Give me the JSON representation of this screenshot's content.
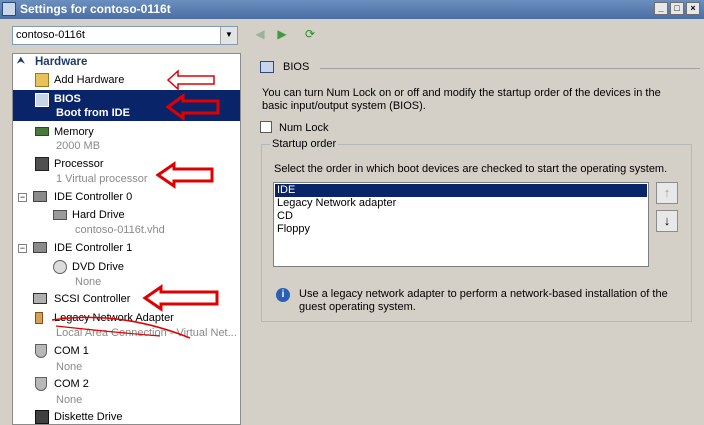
{
  "window": {
    "title": "Settings for contoso-0116t"
  },
  "vm_selector": {
    "value": "contoso-0116t"
  },
  "hardware": {
    "section_label": "Hardware",
    "items": [
      {
        "name": "Add Hardware",
        "icon": "add-hardware-icon"
      },
      {
        "name": "BIOS",
        "sub": "Boot from IDE",
        "icon": "bios-icon"
      },
      {
        "name": "Memory",
        "sub": "2000 MB",
        "icon": "memory-icon"
      },
      {
        "name": "Processor",
        "sub": "1 Virtual processor",
        "icon": "processor-icon"
      },
      {
        "name": "IDE Controller 0",
        "icon": "ide-controller-icon"
      },
      {
        "name": "Hard Drive",
        "sub": "contoso-0116t.vhd",
        "icon": "hard-drive-icon"
      },
      {
        "name": "IDE Controller 1",
        "icon": "ide-controller-icon"
      },
      {
        "name": "DVD Drive",
        "sub": "None",
        "icon": "dvd-drive-icon"
      },
      {
        "name": "SCSI Controller",
        "icon": "scsi-controller-icon"
      },
      {
        "name": "Legacy Network Adapter",
        "sub": "Local Area Connection - Virtual Net...",
        "icon": "network-adapter-icon"
      },
      {
        "name": "COM 1",
        "sub": "None",
        "icon": "com-port-icon"
      },
      {
        "name": "COM 2",
        "sub": "None",
        "icon": "com-port-icon"
      },
      {
        "name": "Diskette Drive",
        "icon": "diskette-icon"
      }
    ]
  },
  "bios_panel": {
    "header": "BIOS",
    "description": "You can turn Num Lock on or off and modify the startup order of the devices in the basic input/output system (BIOS).",
    "num_lock_label": "Num Lock",
    "num_lock_checked": false,
    "startup_group_label": "Startup order",
    "startup_instruction": "Select the order in which boot devices are checked to start the operating system.",
    "boot_devices": [
      "IDE",
      "Legacy Network adapter",
      "CD",
      "Floppy"
    ],
    "selected_device": "IDE",
    "info_text": "Use a legacy network adapter to perform a network-based installation of the guest operating system."
  },
  "colors": {
    "selection": "#0a246a",
    "annotation_red": "#e00000",
    "dialog_bg": "#d4d0c8"
  }
}
